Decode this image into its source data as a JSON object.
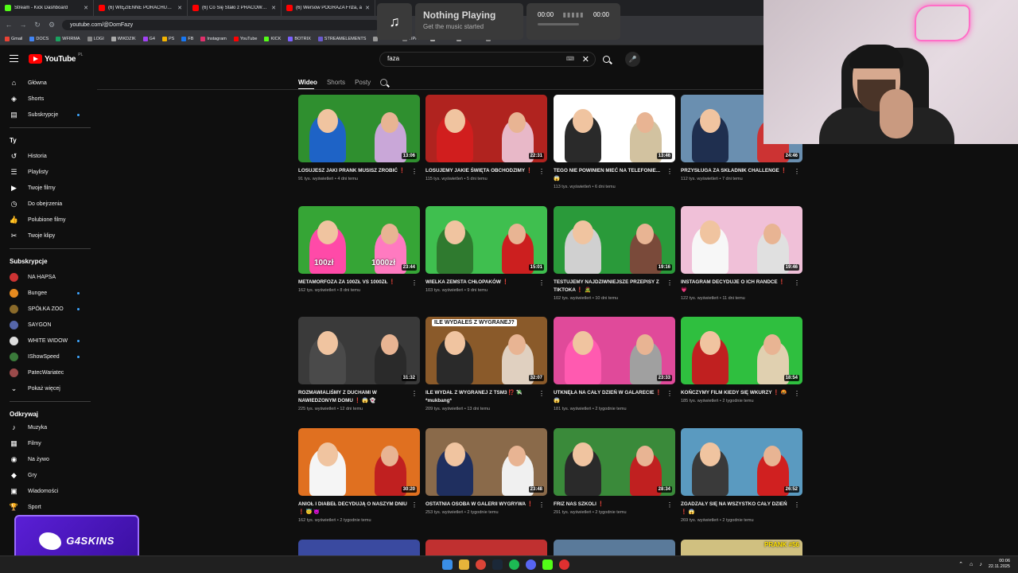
{
  "browser": {
    "tabs": [
      {
        "label": "Stream - Kick Dashboard",
        "color": "#53fc18"
      },
      {
        "label": "(6) WIĘZIENNE PORACHUNKI",
        "color": "#ff0000"
      },
      {
        "label": "(6) Co Się Stało z PRACOWNIK",
        "color": "#ff0000"
      },
      {
        "label": "(6) Wersow POGRAŻA Friza, a",
        "color": "#ff0000"
      }
    ],
    "url": "youtube.com/@DomFazy",
    "bookmarks": [
      "Gmail",
      "DOCS",
      "WFIRMA",
      "LOGI",
      "WIKDZIK",
      "G4",
      "PS",
      "FB",
      "Instagram",
      "YouTube",
      "KICK",
      "BOTRIX",
      "STREAMELEMENTS",
      "TWEET",
      "TIPPLY",
      "TIKER",
      "TIKTOK",
      "NA TAPSIE"
    ]
  },
  "music_widget": {
    "icon": "music-note-icon",
    "title": "Nothing Playing",
    "subtitle": "Get the music started",
    "time_start": "00:00",
    "time_end": "00:00"
  },
  "header": {
    "logo_text": "YouTube",
    "country_code": "PL",
    "search_value": "faza"
  },
  "sidebar": {
    "main": [
      {
        "label": "Główna",
        "icon": "home-icon"
      },
      {
        "label": "Shorts",
        "icon": "shorts-icon"
      },
      {
        "label": "Subskrypcje",
        "icon": "subscriptions-icon",
        "dot": true
      }
    ],
    "you_heading": "Ty",
    "you": [
      {
        "label": "Historia",
        "icon": "history-icon"
      },
      {
        "label": "Playlisty",
        "icon": "playlist-icon"
      },
      {
        "label": "Twoje filmy",
        "icon": "your-videos-icon"
      },
      {
        "label": "Do obejrzenia",
        "icon": "watch-later-icon"
      },
      {
        "label": "Polubione filmy",
        "icon": "like-icon"
      },
      {
        "label": "Twoje klipy",
        "icon": "clips-icon"
      }
    ],
    "subs_heading": "Subskrypcje",
    "subs": [
      {
        "label": "NA HAPSA",
        "color": "#c33"
      },
      {
        "label": "Bungee",
        "color": "#e58a1f",
        "dot": true
      },
      {
        "label": "SPÓŁKA ZOO",
        "color": "#8a6a2a",
        "dot": true
      },
      {
        "label": "SAYGON",
        "color": "#5566aa"
      },
      {
        "label": "WHITE WIDOW",
        "color": "#ddd",
        "dot": true
      },
      {
        "label": "IShowSpeed",
        "color": "#3a7a3a",
        "dot": true
      },
      {
        "label": "PatecWariatec",
        "color": "#9a4a4a"
      }
    ],
    "show_more": "Pokaż więcej",
    "explore_heading": "Odkrywaj",
    "explore": [
      {
        "label": "Muzyka",
        "icon": "music-icon"
      },
      {
        "label": "Filmy",
        "icon": "film-icon"
      },
      {
        "label": "Na żywo",
        "icon": "live-icon"
      },
      {
        "label": "Gry",
        "icon": "gaming-icon"
      },
      {
        "label": "Wiadomości",
        "icon": "news-icon"
      },
      {
        "label": "Sport",
        "icon": "trophy-icon"
      }
    ]
  },
  "channel_tabs": [
    "Wideo",
    "Shorts",
    "Posty"
  ],
  "videos": [
    {
      "title": "LOSUJESZ JAKI PRANK MUSISZ ZROBIĆ ❗",
      "views": "91 tys. wyświetleń",
      "age": "4 dni temu",
      "duration": "13:06",
      "bg": "#2f8f2f",
      "c1": "#1e63c6",
      "c2": "#c9a7d8"
    },
    {
      "title": "LOSUJEMY JAKIE ŚWIĘTA OBCHODZIMY ❗",
      "views": "115 tys. wyświetleń",
      "age": "5 dni temu",
      "duration": "22:31",
      "bg": "#b0231f",
      "c1": "#d11e1e",
      "c2": "#e8b8c8"
    },
    {
      "title": "TEGO NIE POWINIEN MIEĆ NA TELEFONIE... 😱",
      "views": "113 tys. wyświetleń",
      "age": "6 dni temu",
      "duration": "13:46",
      "bg": "#ffffff",
      "c1": "#2a2a2a",
      "c2": "#d2c2a0"
    },
    {
      "title": "PRZYSŁUGA ZA SKŁADNIK CHALLENGE ❗",
      "views": "112 tys. wyświetleń",
      "age": "7 dni temu",
      "duration": "24:46",
      "bg": "#6a8fb0",
      "c1": "#1f2f4f",
      "c2": "#cc3333"
    },
    {
      "title": "METAMORFOZA ZA 100ZŁ VS 1000ZŁ ❗",
      "views": "162 tys. wyświetleń",
      "age": "8 dni temu",
      "duration": "23:44",
      "bg": "#36a536",
      "c1": "#ff4aa8",
      "c2": "#ff7ac0",
      "badge1": "100zł",
      "badge2": "1000zł"
    },
    {
      "title": "WIELKA ZEMSTA CHŁOPAKÓW ❗",
      "views": "103 tys. wyświetleń",
      "age": "9 dni temu",
      "duration": "15:01",
      "bg": "#3fbf4f",
      "c1": "#2f7a2f",
      "c2": "#cc1f1f"
    },
    {
      "title": "TESTUJEMY NAJDZIWNIEJSZE PRZEPISY Z TIKTOKA ❗ 🧟",
      "views": "102 tys. wyświetleń",
      "age": "10 dni temu",
      "duration": "19:16",
      "bg": "#2a9a3a",
      "c1": "#d0d0d0",
      "c2": "#7a4a3a"
    },
    {
      "title": "INSTAGRAM DECYDUJE O ICH RANDCE ❗ 💗",
      "views": "122 tys. wyświetleń",
      "age": "11 dni temu",
      "duration": "19:46",
      "bg": "#f0c0d8",
      "c1": "#f7f7f7",
      "c2": "#e0e0e0"
    },
    {
      "title": "ROZMAWIALIŚMY Z DUCHAMI W NAWIEDZONYM DOMU ❗ 😱 👻",
      "views": "225 tys. wyświetleń",
      "age": "12 dni temu",
      "duration": "31:32",
      "bg": "#3a3a3a",
      "c1": "#4a4a4a",
      "c2": "#2a2a2a"
    },
    {
      "title": "ILE WYDAŁ Z WYGRANEJ Z TSM3 ⁉️ 💸 *mukbang*",
      "views": "209 tys. wyświetleń",
      "age": "13 dni temu",
      "duration": "32:07",
      "bg": "#8a5a2a",
      "c1": "#2a2a2a",
      "c2": "#e0d0c0",
      "banner": "ILE WYDAŁEŚ Z WYGRANEJ?"
    },
    {
      "title": "UTKNĘŁA NA CAŁY DZIEŃ W GALARECIE ❗ 😱",
      "views": "181 tys. wyświetleń",
      "age": "2 tygodnie temu",
      "duration": "23:33",
      "bg": "#e04a9a",
      "c1": "#ff5ab0",
      "c2": "#a0a0a0"
    },
    {
      "title": "KOŃCZYMY FILM KIEDY SIĘ WKURZY ❗ 🤬",
      "views": "185 tys. wyświetleń",
      "age": "2 tygodnie temu",
      "duration": "18:54",
      "bg": "#2fbf3f",
      "c1": "#c02020",
      "c2": "#e0d0b0"
    },
    {
      "title": "ANIOŁ I DIABEŁ DECYDUJĄ O NASZYM DNIU ❗ 😇 👿",
      "views": "162 tys. wyświetleń",
      "age": "2 tygodnie temu",
      "duration": "30:20",
      "bg": "#e07020",
      "c1": "#f5f5f5",
      "c2": "#c02020"
    },
    {
      "title": "OSTATNIA OSOBA W GALERII WYGRYWA ❗",
      "views": "253 tys. wyświetleń",
      "age": "2 tygodnie temu",
      "duration": "23:48",
      "bg": "#8a6a4a",
      "c1": "#1f2f5f",
      "c2": "#f0f0f0"
    },
    {
      "title": "FRIZ NAS SZKOLI ❗",
      "views": "291 tys. wyświetleń",
      "age": "2 tygodnie temu",
      "duration": "28:34",
      "bg": "#3a8a3a",
      "c1": "#2a2a2a",
      "c2": "#c02020"
    },
    {
      "title": "ZGADZAŁY SIĘ NA WSZYSTKO CAŁY DZIEŃ ❗ 😱",
      "views": "269 tys. wyświetleń",
      "age": "2 tygodnie temu",
      "duration": "26:52",
      "bg": "#5a9ac0",
      "c1": "#3a3a3a",
      "c2": "#d02020"
    }
  ],
  "next_row_badge": "PRANK #56",
  "sponsor_text": "G4SKINS",
  "taskbar": {
    "time": "00:06",
    "date": "22.11.2025"
  }
}
